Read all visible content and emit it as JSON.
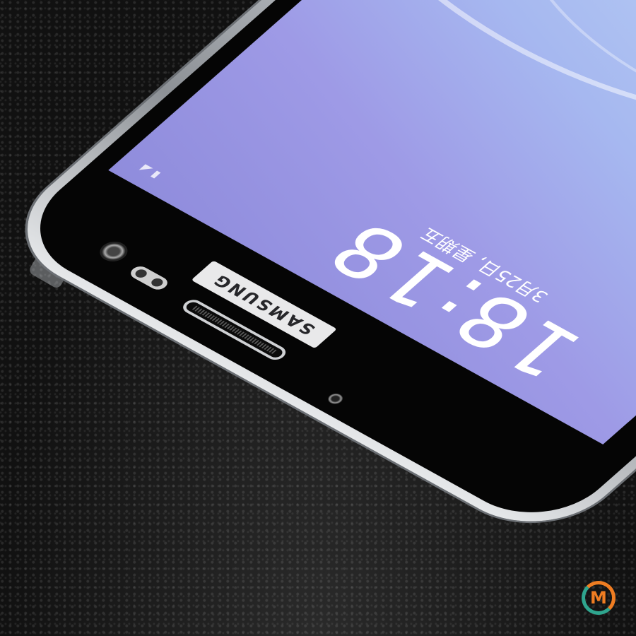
{
  "screen": {
    "clock": "18:18",
    "date": "3月25日, 星期五",
    "status_icons": [
      "sim-icon",
      "signal-icon"
    ],
    "colors": {
      "wallpaper_top": "#b8cef4",
      "wallpaper_bottom": "#8f8cdc"
    }
  },
  "bezel": {
    "brand": "SAMSUNG"
  },
  "watermark": {
    "logo_text": "M",
    "colors": [
      "#ef7d22",
      "#2fa58e"
    ]
  },
  "background": {
    "surface": "black-leather",
    "color": "#141414"
  }
}
